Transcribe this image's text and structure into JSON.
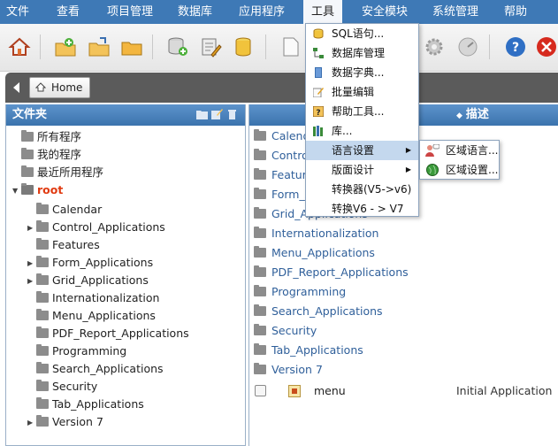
{
  "menubar": {
    "items": [
      "文件",
      "查看",
      "项目管理",
      "数据库",
      "应用程序",
      "工具",
      "安全模块",
      "系统管理",
      "帮助"
    ],
    "active_index": 5
  },
  "breadcrumb": {
    "home_label": "Home"
  },
  "folders_panel": {
    "title": "文件夹",
    "tree": [
      {
        "label": "所有程序",
        "level": 0,
        "toggle": ""
      },
      {
        "label": "我的程序",
        "level": 0,
        "toggle": ""
      },
      {
        "label": "最近所用程序",
        "level": 0,
        "toggle": ""
      },
      {
        "label": "root",
        "level": 0,
        "toggle": "▼"
      },
      {
        "label": "Calendar",
        "level": 1,
        "toggle": ""
      },
      {
        "label": "Control_Applications",
        "level": 1,
        "toggle": "▶"
      },
      {
        "label": "Features",
        "level": 1,
        "toggle": ""
      },
      {
        "label": "Form_Applications",
        "level": 1,
        "toggle": "▶"
      },
      {
        "label": "Grid_Applications",
        "level": 1,
        "toggle": "▶"
      },
      {
        "label": "Internationalization",
        "level": 1,
        "toggle": ""
      },
      {
        "label": "Menu_Applications",
        "level": 1,
        "toggle": ""
      },
      {
        "label": "PDF_Report_Applications",
        "level": 1,
        "toggle": ""
      },
      {
        "label": "Programming",
        "level": 1,
        "toggle": ""
      },
      {
        "label": "Search_Applications",
        "level": 1,
        "toggle": ""
      },
      {
        "label": "Security",
        "level": 1,
        "toggle": ""
      },
      {
        "label": "Tab_Applications",
        "level": 1,
        "toggle": ""
      },
      {
        "label": "Version 7",
        "level": 1,
        "toggle": "▶"
      }
    ]
  },
  "content_panel": {
    "desc_header": "描述",
    "sort_icon": "sort-icon",
    "folders": [
      "Calendar",
      "Control_Applications",
      "Features",
      "Form_Applications",
      "Grid_Applications",
      "Internationalization",
      "Menu_Applications",
      "PDF_Report_Applications",
      "Programming",
      "Search_Applications",
      "Security",
      "Tab_Applications",
      "Version 7"
    ],
    "file": {
      "name": "menu",
      "description": "Initial Application"
    }
  },
  "tools_menu": {
    "items": [
      {
        "label": "SQL语句...",
        "icon": "database-icon",
        "submenu": false
      },
      {
        "label": "数据库管理",
        "icon": "network-icon",
        "submenu": false
      },
      {
        "label": "数据字典...",
        "icon": "dictionary-icon",
        "submenu": false
      },
      {
        "label": "批量编辑",
        "icon": "edit-icon",
        "submenu": false
      },
      {
        "label": "帮助工具...",
        "icon": "help-tool-icon",
        "submenu": false
      },
      {
        "label": "库...",
        "icon": "library-icon",
        "submenu": false
      },
      {
        "label": "语言设置",
        "icon": "",
        "submenu": true
      },
      {
        "label": "版面设计",
        "icon": "",
        "submenu": true
      },
      {
        "label": "转换器(V5->v6)",
        "icon": "",
        "submenu": false
      },
      {
        "label": "转换V6 - > V7",
        "icon": "",
        "submenu": false
      }
    ],
    "highlighted_index": 6
  },
  "language_submenu": {
    "items": [
      {
        "label": "区域语言...",
        "icon": "users-icon"
      },
      {
        "label": "区域设置...",
        "icon": "globe-icon"
      }
    ]
  },
  "colors": {
    "menubar": "#3e79b6",
    "panel_header": "#4a82bd",
    "highlight": "#c4d8ee",
    "root_label": "#e03a10",
    "folder_link": "#2f5f9a"
  }
}
